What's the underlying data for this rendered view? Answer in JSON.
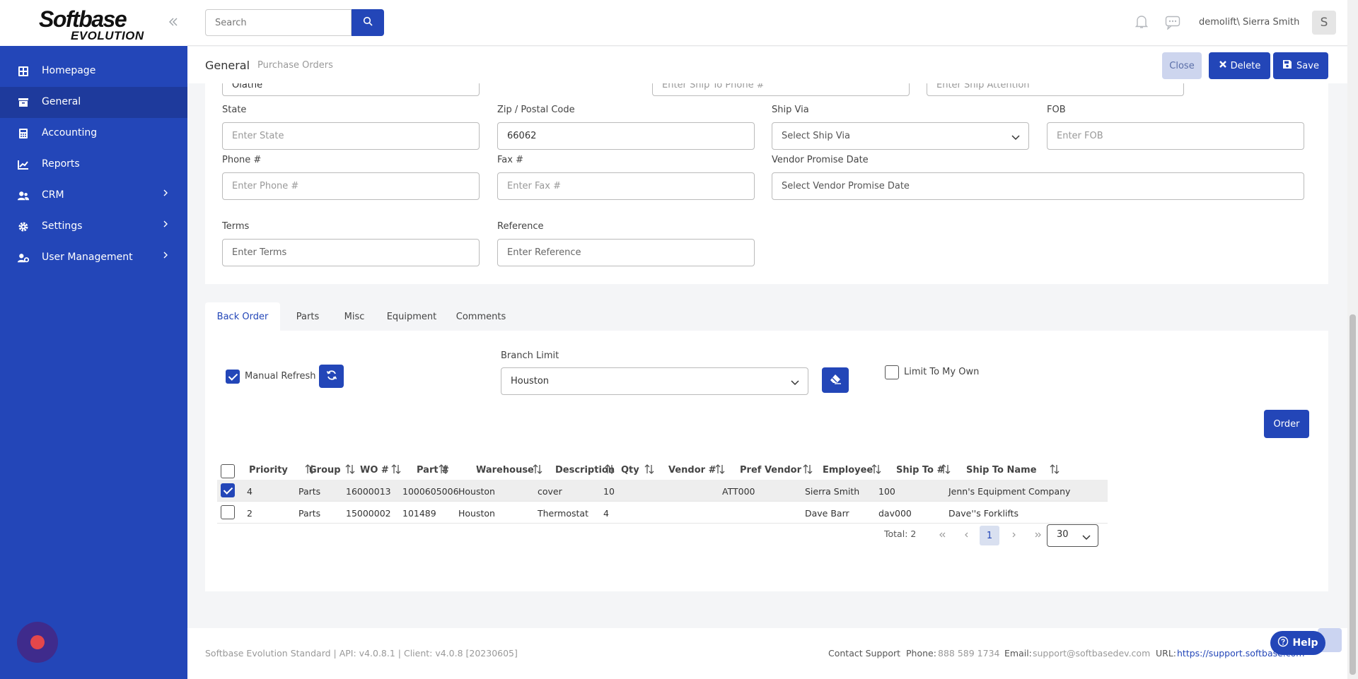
{
  "app": {
    "logo_main": "Softbase",
    "logo_sub": "EVOLUTION"
  },
  "sidebar": {
    "items": [
      {
        "label": "Homepage",
        "icon": "grid-icon"
      },
      {
        "label": "General",
        "icon": "folder-icon",
        "active": true
      },
      {
        "label": "Accounting",
        "icon": "calculator-icon"
      },
      {
        "label": "Reports",
        "icon": "chart-icon"
      },
      {
        "label": "CRM",
        "icon": "users-icon",
        "expandable": true
      },
      {
        "label": "Settings",
        "icon": "gear-icon",
        "expandable": true
      },
      {
        "label": "User Management",
        "icon": "user-gear-icon",
        "expandable": true
      }
    ]
  },
  "header": {
    "search_placeholder": "Search",
    "username": "demolift\\ Sierra Smith",
    "avatar_initial": "S"
  },
  "breadcrumb": {
    "main": "General",
    "sub": "Purchase Orders"
  },
  "actions": {
    "close": "Close",
    "delete": "Delete",
    "save": "Save"
  },
  "form": {
    "city_value": "Olathe",
    "ship_to_phone_placeholder": "Enter Ship To Phone #",
    "ship_attention_placeholder": "Enter Ship Attention",
    "state_label": "State",
    "state_placeholder": "Enter State",
    "zip_label": "Zip / Postal Code",
    "zip_value": "66062",
    "ship_via_label": "Ship Via",
    "ship_via_placeholder": "Select Ship Via",
    "fob_label": "FOB",
    "fob_placeholder": "Enter FOB",
    "phone_label": "Phone #",
    "phone_placeholder": "Enter Phone #",
    "fax_label": "Fax #",
    "fax_placeholder": "Enter Fax #",
    "vendor_promise_label": "Vendor Promise Date",
    "vendor_promise_placeholder": "Select Vendor Promise Date",
    "terms_label": "Terms",
    "terms_placeholder": "Enter Terms",
    "reference_label": "Reference",
    "reference_placeholder": "Enter Reference"
  },
  "tabs": [
    "Back Order",
    "Parts",
    "Misc",
    "Equipment",
    "Comments"
  ],
  "back_order": {
    "manual_refresh_label": "Manual Refresh",
    "manual_refresh_checked": true,
    "branch_limit_label": "Branch Limit",
    "branch_limit_value": "Houston",
    "limit_to_my_own_label": "Limit To My Own",
    "limit_to_my_own_checked": false,
    "order_button": "Order",
    "columns": [
      "Priority",
      "Group",
      "WO #",
      "Part #",
      "Warehouse",
      "Description",
      "Qty",
      "Vendor #",
      "Pref Vendor",
      "Employee",
      "Ship To #",
      "Ship To Name"
    ],
    "rows": [
      {
        "selected": true,
        "cells": [
          "4",
          "Parts",
          "16000013",
          "1000605006",
          "Houston",
          "cover",
          "10",
          "",
          "ATT000",
          "Sierra Smith",
          "100",
          "Jenn's Equipment Company"
        ]
      },
      {
        "selected": false,
        "cells": [
          "2",
          "Parts",
          "15000002",
          "101489",
          "Houston",
          "Thermostat",
          "4",
          "",
          "",
          "Dave Barr",
          "dav000",
          "Dave''s Forklifts"
        ]
      }
    ],
    "total_text": "Total: 2",
    "current_page": "1",
    "page_size": "30"
  },
  "footer": {
    "version": "Softbase Evolution Standard | API: v4.0.8.1 | Client: v4.0.8 [20230605]",
    "contact_label": "Contact Support",
    "phone_label": "Phone:",
    "phone_value": "888 589 1734",
    "email_label": "Email:",
    "email_value": "support@softbasedev.com",
    "url_label": "URL:",
    "url_value": "https://support.softbase.com",
    "help_label": "Help"
  },
  "colors": {
    "primary": "#2346b8",
    "sidebar_active": "#1e3a9c",
    "record": "#e4474b"
  }
}
